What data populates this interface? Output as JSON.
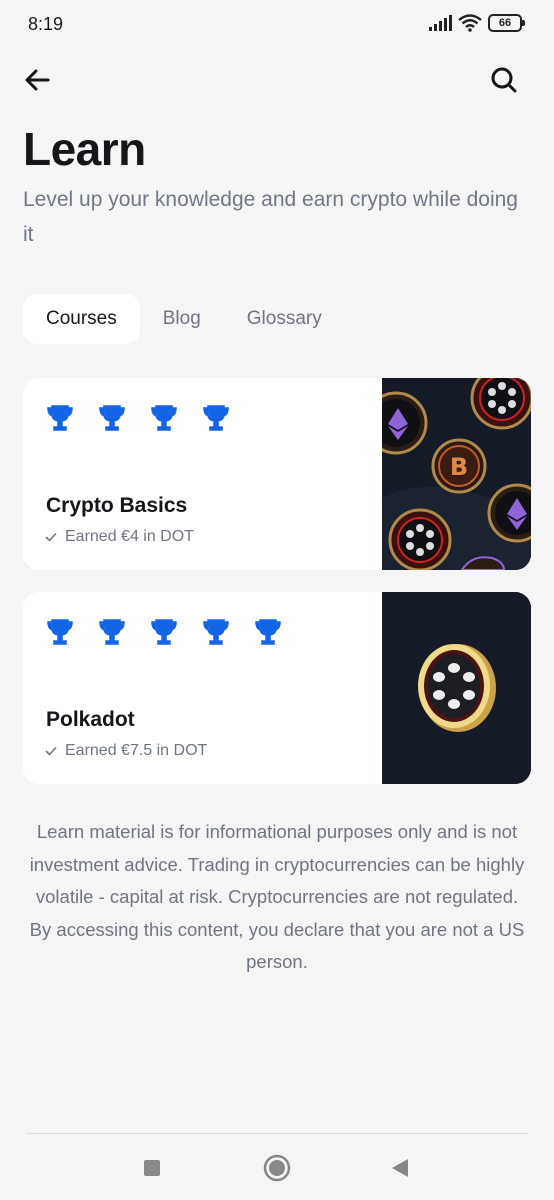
{
  "status_bar": {
    "time": "8:19",
    "battery": "66"
  },
  "page": {
    "title": "Learn",
    "subtitle": "Level up your knowledge and earn crypto while doing it"
  },
  "tabs": [
    {
      "label": "Courses",
      "active": true
    },
    {
      "label": "Blog",
      "active": false
    },
    {
      "label": "Glossary",
      "active": false
    }
  ],
  "courses": [
    {
      "title": "Crypto Basics",
      "earned": "Earned €4 in DOT",
      "trophies": 4
    },
    {
      "title": "Polkadot",
      "earned": "Earned €7.5 in DOT",
      "trophies": 5
    }
  ],
  "disclaimer": "Learn material is for informational purposes only and is not investment advice. Trading in cryptocurrencies can be highly volatile - capital at risk. Cryptocurrencies are not regulated. By accessing this content, you declare that you are not a US person.",
  "icons": {
    "back": "arrow-left-icon",
    "search": "search-icon",
    "trophy": "trophy-icon",
    "check": "check-icon",
    "nav_recent": "square-icon",
    "nav_home": "circle-icon",
    "nav_back": "triangle-back-icon"
  },
  "colors": {
    "accent": "#1464e6",
    "background": "#f5f5f5",
    "card": "#ffffff",
    "text_primary": "#15161a",
    "text_secondary": "#6f7583",
    "image_bg": "#151b26"
  }
}
